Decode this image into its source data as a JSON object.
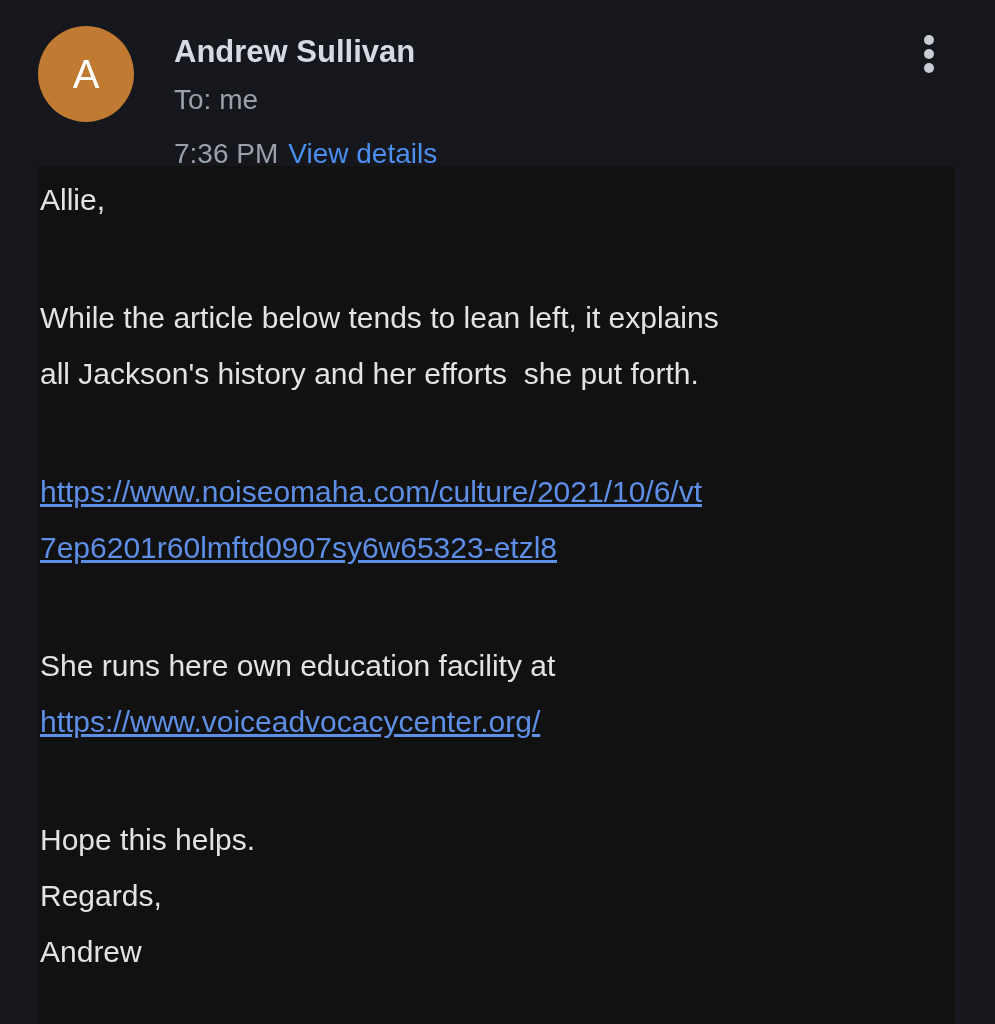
{
  "sender": {
    "avatar_letter": "A",
    "name": "Andrew Sullivan",
    "to": "To: me",
    "time": "7:36 PM",
    "details_link": "View details"
  },
  "body": [
    {
      "lines": [
        {
          "kind": "text",
          "text": "Allie,"
        }
      ]
    },
    {
      "lines": [
        {
          "kind": "text",
          "text": "While the article below tends to lean left, it explains"
        },
        {
          "kind": "text",
          "text": "all Jackson's history and her efforts  she put forth."
        }
      ]
    },
    {
      "lines": [
        {
          "kind": "link",
          "text": "https://www.noiseomaha.com/culture/2021/10/6/vt"
        },
        {
          "kind": "link",
          "text": "7ep6201r60lmftd0907sy6w65323-etzl8"
        }
      ]
    },
    {
      "lines": [
        {
          "kind": "text",
          "text": "She runs here own education facility at"
        },
        {
          "kind": "link",
          "text": "https://www.voiceadvocacycenter.org/"
        }
      ]
    },
    {
      "lines": [
        {
          "kind": "text",
          "text": "Hope this helps."
        },
        {
          "kind": "text",
          "text": "Regards,"
        },
        {
          "kind": "text",
          "text": "Andrew"
        }
      ]
    }
  ]
}
